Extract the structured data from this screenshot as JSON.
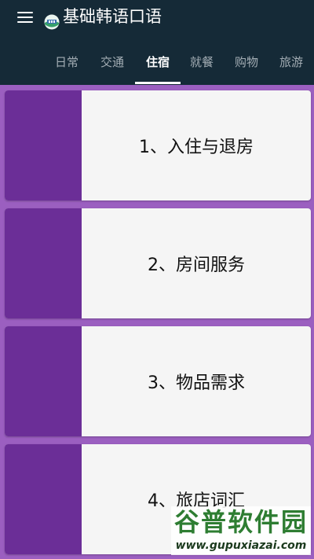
{
  "app": {
    "title": "基础韩语口语",
    "logo_icon": "app-logo-icon"
  },
  "tabs": [
    {
      "label": "日常",
      "active": false
    },
    {
      "label": "交通",
      "active": false
    },
    {
      "label": "住宿",
      "active": true
    },
    {
      "label": "就餐",
      "active": false
    },
    {
      "label": "购物",
      "active": false
    },
    {
      "label": "旅游",
      "active": false
    }
  ],
  "lessons": [
    {
      "label": "1、入住与退房"
    },
    {
      "label": "2、房间服务"
    },
    {
      "label": "3、物品需求"
    },
    {
      "label": "4、旅店词汇"
    }
  ],
  "watermark": {
    "brand": "谷普软件园",
    "url": "www.gupuxiazai.com"
  },
  "colors": {
    "appbar": "#152a37",
    "background": "#9b5fc0",
    "card_accent": "#6b2e97",
    "card": "#f5f5f5",
    "tab_inactive": "#a3adb4",
    "tab_active": "#ffffff"
  }
}
